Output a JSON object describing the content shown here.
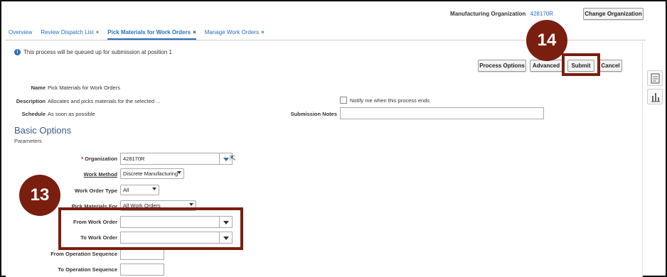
{
  "header": {
    "org_label": "Manufacturing Organization",
    "org_value": "428170R",
    "change_org_button": "Change Organization"
  },
  "tabs": [
    {
      "label": "Overview",
      "closable": false,
      "active": false
    },
    {
      "label": "Review Dispatch List",
      "closable": true,
      "active": false
    },
    {
      "label": "Pick Materials for Work Orders",
      "closable": true,
      "active": true
    },
    {
      "label": "Manage Work Orders",
      "closable": true,
      "active": false
    }
  ],
  "close_glyph": "×",
  "info_message": "This process will be queued up for submission at position 1",
  "actions": {
    "process_options": "Process Options",
    "advanced": "Advanced",
    "submit": "Submit",
    "cancel": "Cancel"
  },
  "process": {
    "name_label": "Name",
    "name_value": "Pick Materials for Work Orders",
    "description_label": "Description",
    "description_value": "Allocates and picks materials for the selected ...",
    "schedule_label": "Schedule",
    "schedule_value": "As soon as possible",
    "notify_label": "Notify me when this process ends",
    "submission_notes_label": "Submission Notes",
    "submission_notes_value": ""
  },
  "basic_options": {
    "heading": "Basic Options",
    "subheading": "Parameters",
    "required_marker": "*",
    "organization_label": "Organization",
    "organization_value": "428170R",
    "work_method_label": "Work Method",
    "work_method_value": "Discrete Manufacturing",
    "work_order_type_label": "Work Order Type",
    "work_order_type_value": "All",
    "pick_materials_for_label": "Pick Materials For",
    "pick_materials_for_value": "All Work Orders",
    "from_work_order_label": "From Work Order",
    "from_work_order_value": "",
    "to_work_order_label": "To Work Order",
    "to_work_order_value": "",
    "from_operation_sequence_label": "From Operation Sequence",
    "from_operation_sequence_value": "",
    "to_operation_sequence_label": "To Operation Sequence",
    "to_operation_sequence_value": ""
  },
  "callouts": {
    "step_13": "13",
    "step_14": "14"
  },
  "colors": {
    "link": "#2a6ebb",
    "callout": "#7a1e0f",
    "heading": "#3c5a88"
  },
  "icons": {
    "info": "info-icon",
    "side_doc": "document-icon",
    "side_chart": "bar-chart-icon",
    "cursor": "mouse-cursor-icon"
  }
}
